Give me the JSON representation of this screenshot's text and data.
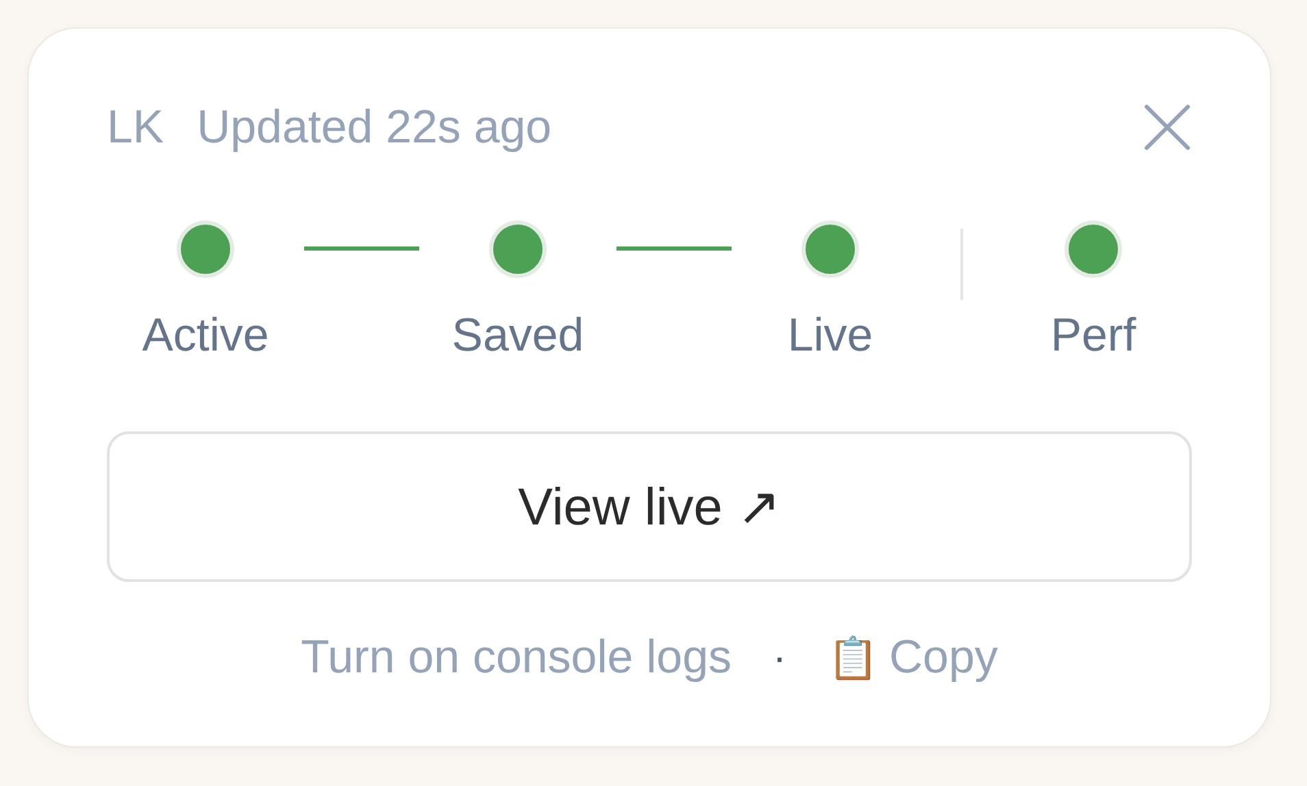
{
  "header": {
    "initials": "LK",
    "updated": "Updated 22s ago"
  },
  "steps": [
    {
      "label": "Active",
      "color": "#4ca154"
    },
    {
      "label": "Saved",
      "color": "#4ca154",
      "kind": "line"
    },
    {
      "label": "Live",
      "color": "#4ca154",
      "kind": "line"
    },
    {
      "label": "Perf",
      "color": "#4ca154",
      "kind": "divider"
    }
  ],
  "button": {
    "label": "View live ↗"
  },
  "footer": {
    "link": "Turn on console logs",
    "separator": "·",
    "copy_icon": "📋",
    "copy": "Copy"
  }
}
